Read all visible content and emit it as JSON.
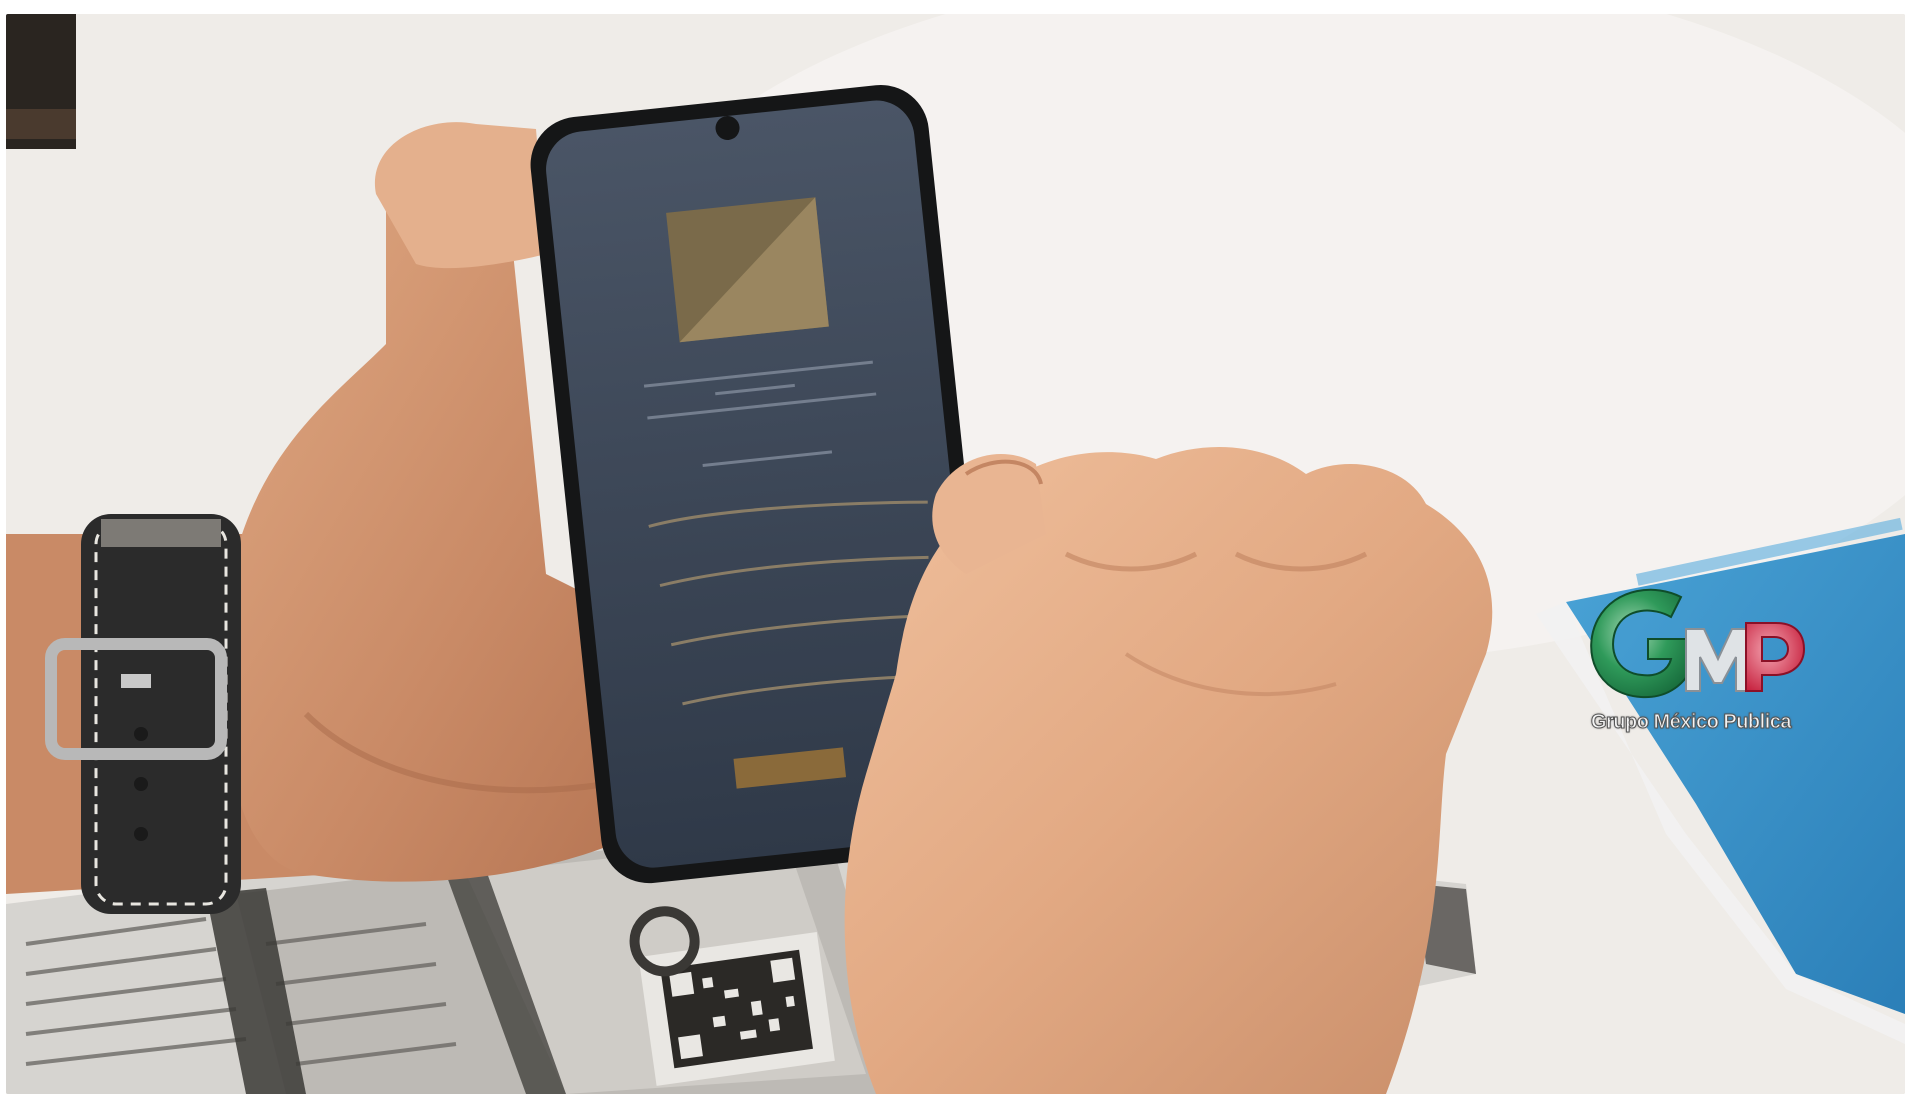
{
  "watermark": {
    "letters": "GMP",
    "text": "Grupo México Publica",
    "colors": {
      "g": "#1f8a4c",
      "m": "#d0d6db",
      "p": "#d8324a"
    }
  },
  "scene": {
    "description_icons": [
      "smartphone-icon",
      "hand-icon",
      "watch-icon",
      "qr-code-icon"
    ]
  }
}
